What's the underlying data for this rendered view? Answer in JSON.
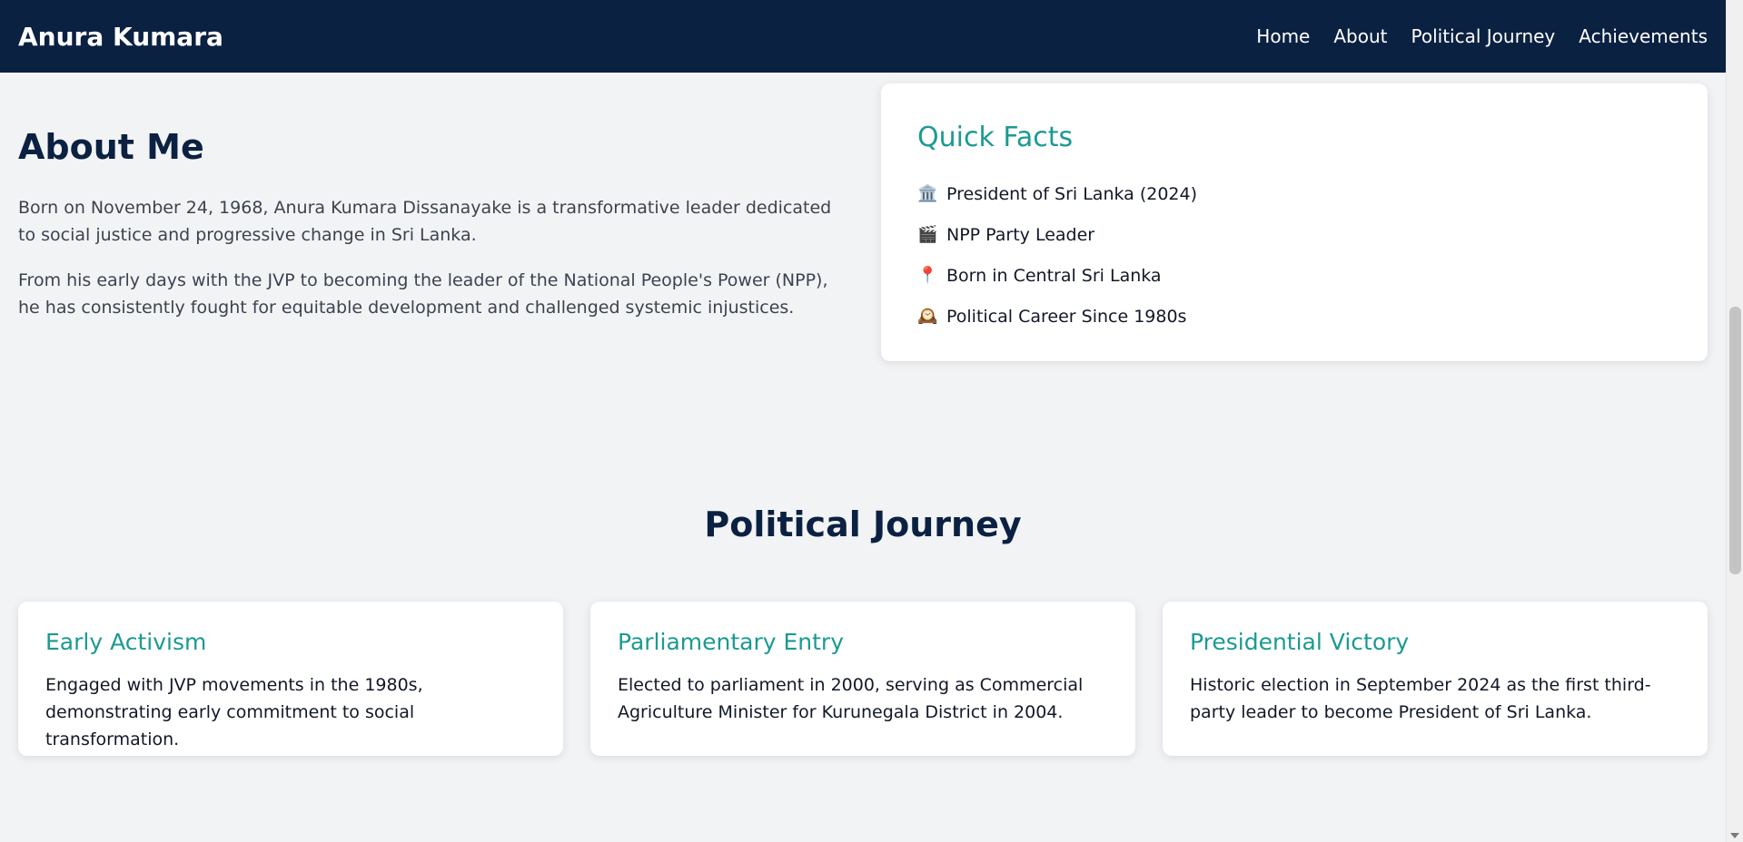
{
  "header": {
    "brand": "Anura Kumara",
    "nav": [
      "Home",
      "About",
      "Political Journey",
      "Achievements"
    ]
  },
  "about": {
    "title": "About Me",
    "paragraphs": [
      "Born on November 24, 1968, Anura Kumara Dissanayake is a transformative leader dedicated to social justice and progressive change in Sri Lanka.",
      "From his early days with the JVP to becoming the leader of the National People's Power (NPP), he has consistently fought for equitable development and challenged systemic injustices."
    ]
  },
  "facts": {
    "title": "Quick Facts",
    "items": [
      {
        "icon": "🏛️",
        "text": "President of Sri Lanka (2024)"
      },
      {
        "icon": "🎬",
        "text": "NPP Party Leader"
      },
      {
        "icon": "📍",
        "text": "Born in Central Sri Lanka"
      },
      {
        "icon": "🕰️",
        "text": "Political Career Since 1980s"
      }
    ]
  },
  "journey": {
    "title": "Political Journey",
    "cards": [
      {
        "title": "Early Activism",
        "text": "Engaged with JVP movements in the 1980s, demonstrating early commitment to social transformation."
      },
      {
        "title": "Parliamentary Entry",
        "text": "Elected to parliament in 2000, serving as Commercial Agriculture Minister for Kurunegala District in 2004."
      },
      {
        "title": "Presidential Victory",
        "text": "Historic election in September 2024 as the first third-party leader to become President of Sri Lanka."
      }
    ]
  },
  "colors": {
    "nav_bg": "#0b2142",
    "accent": "#1b9a92",
    "page_bg": "#f2f3f5"
  }
}
